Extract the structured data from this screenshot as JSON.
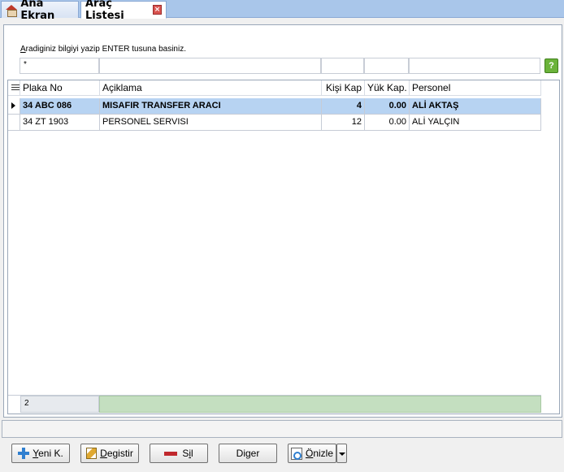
{
  "tabs": [
    {
      "label": "Ana Ekran",
      "icon": "home-icon"
    },
    {
      "label": "Araç Listesi",
      "icon": "close-icon",
      "active": true
    }
  ],
  "search": {
    "hint": "Aradiginiz bilgiyi yazip ENTER tusuna basiniz.",
    "filter_values": [
      "*",
      "",
      "",
      "",
      ""
    ]
  },
  "grid": {
    "columns": [
      "Plaka No",
      "Açiklama",
      "Kişi Kap",
      "Yük Kap.",
      "Personel"
    ],
    "rows": [
      {
        "plaka": "34 ABC 086",
        "aciklama": "MISAFIR TRANSFER ARACI",
        "kisi_kap": "4",
        "yuk_kap": "0.00",
        "personel": "ALİ AKTAŞ",
        "selected": true
      },
      {
        "plaka": "34 ZT 1903",
        "aciklama": "PERSONEL SERVISI",
        "kisi_kap": "12",
        "yuk_kap": "0.00",
        "personel": "ALİ YALÇIN",
        "selected": false
      }
    ],
    "footer_count": "2"
  },
  "buttons": {
    "new": "Yeni K.",
    "edit": "Degistir",
    "delete": "Sil",
    "other": "Diger",
    "preview": "Önizle"
  },
  "colors": {
    "selected_row": "#b7d3f2",
    "tabbar": "#a9c6ea",
    "footer_green": "#c4dfc0"
  }
}
